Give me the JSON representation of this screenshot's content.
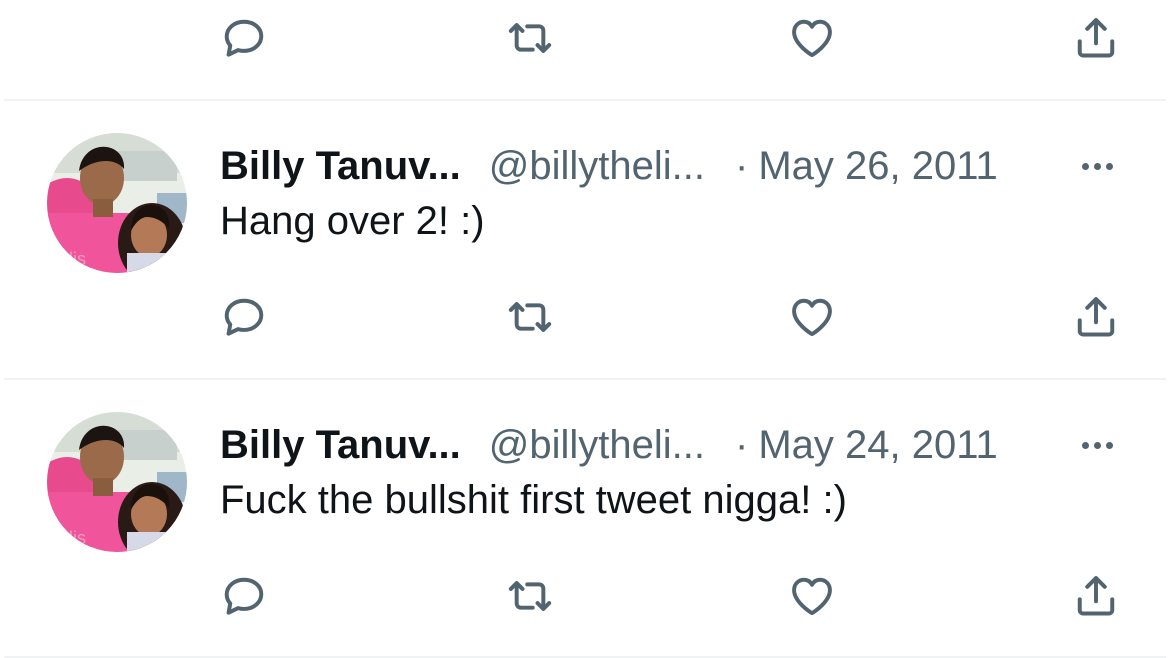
{
  "timeline": {
    "tweets": [
      {
        "author_name": "Billy Tanuv...",
        "handle": "@billytheli...",
        "separator": "·",
        "date": "May 26, 2011",
        "text": "Hang over 2! :)"
      },
      {
        "author_name": "Billy Tanuv...",
        "handle": "@billytheli...",
        "separator": "·",
        "date": "May 24, 2011",
        "text": "Fuck the bullshit first tweet nigga! :)"
      }
    ],
    "icons": {
      "reply": "reply-icon",
      "retweet": "retweet-icon",
      "like": "heart-icon",
      "share": "share-icon",
      "more": "more-icon"
    },
    "colors": {
      "icon_gray": "#536471",
      "text_primary": "#0f1419",
      "divider": "#eff3f4"
    }
  }
}
